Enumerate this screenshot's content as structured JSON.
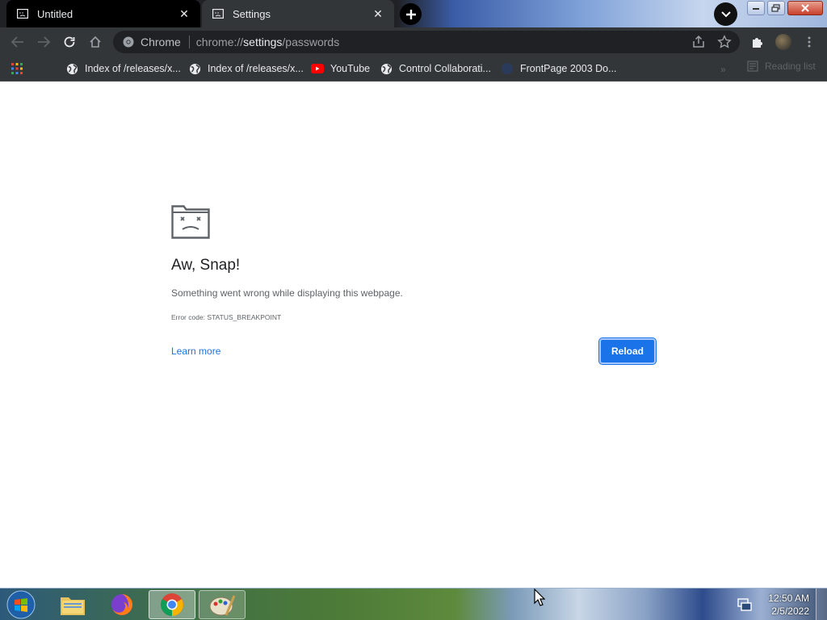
{
  "tabs": [
    {
      "title": "Untitled"
    },
    {
      "title": "Settings"
    }
  ],
  "omnibox": {
    "chip": "Chrome",
    "url_prefix": "chrome://",
    "url_host": "settings",
    "url_path": "/passwords"
  },
  "bookmarks": [
    {
      "label": "Index of /releases/x...",
      "icon": "globe-icon"
    },
    {
      "label": "Index of /releases/x...",
      "icon": "globe-icon"
    },
    {
      "label": "YouTube",
      "icon": "youtube-icon"
    },
    {
      "label": "Control Collaborati...",
      "icon": "globe-icon"
    },
    {
      "label": "FrontPage 2003 Do...",
      "icon": "page-icon"
    }
  ],
  "bookmarks_more": "»",
  "reading_list": "Reading list",
  "error_page": {
    "title": "Aw, Snap!",
    "message": "Something went wrong while displaying this webpage.",
    "code": "Error code: STATUS_BREAKPOINT",
    "learn_more": "Learn more",
    "reload": "Reload"
  },
  "taskbar": {
    "apps": [
      "start-orb",
      "file-explorer",
      "firefox",
      "chrome",
      "paint"
    ],
    "time": "12:50 AM",
    "date": "2/5/2022"
  },
  "colors": {
    "accent": "#1a73e8",
    "toolbar": "#323639",
    "active_tab": "#000000"
  }
}
